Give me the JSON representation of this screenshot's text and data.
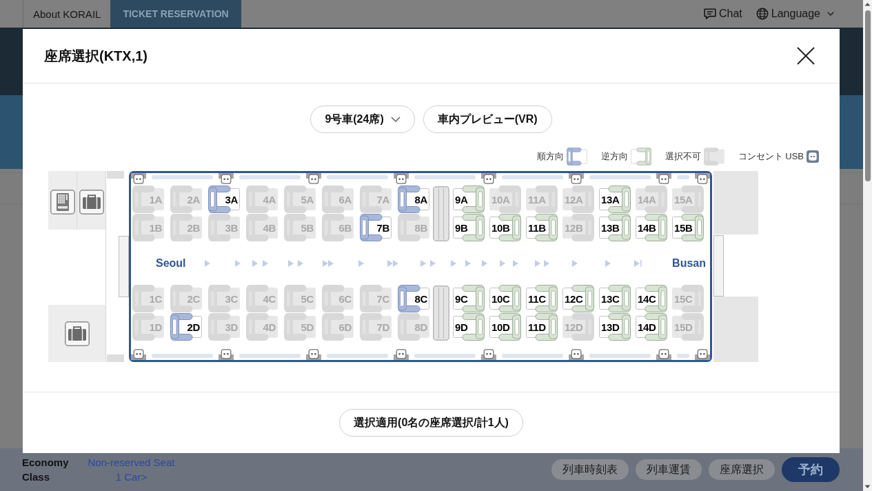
{
  "top_nav": {
    "items": [
      {
        "label": "About KORAIL",
        "selected": false
      },
      {
        "label": "TICKET RESERVATION",
        "selected": true
      }
    ],
    "chat": "Chat",
    "language": "Language"
  },
  "modal": {
    "title": "座席選択(KTX,1)",
    "car_dropdown": "9号車(24席)",
    "vr_button": "車内プレビュー(VR)",
    "legend": [
      {
        "kind": "forward",
        "label": "順方向"
      },
      {
        "kind": "reverse",
        "label": "逆方向"
      },
      {
        "kind": "unavailable",
        "label": "選択不可"
      },
      {
        "kind": "outlet",
        "label": "コンセント USB"
      }
    ],
    "seat_map": {
      "origin": "Seoul",
      "destination": "Busan",
      "rows": [
        {
          "seats": [
            {
              "label": "1A",
              "kind": "forward",
              "available": false
            },
            {
              "label": "2A",
              "kind": "forward",
              "available": false
            },
            {
              "label": "3A",
              "kind": "forward",
              "available": true
            },
            {
              "label": "4A",
              "kind": "forward",
              "available": false
            },
            {
              "label": "5A",
              "kind": "forward",
              "available": false
            },
            {
              "label": "6A",
              "kind": "forward",
              "available": false
            },
            {
              "label": "7A",
              "kind": "forward",
              "available": false
            },
            {
              "label": "8A",
              "kind": "forward",
              "available": true
            },
            {
              "label": "9A",
              "kind": "reverse",
              "available": true
            },
            {
              "label": "10A",
              "kind": "reverse",
              "available": false
            },
            {
              "label": "11A",
              "kind": "reverse",
              "available": false
            },
            {
              "label": "12A",
              "kind": "reverse",
              "available": false
            },
            {
              "label": "13A",
              "kind": "reverse",
              "available": true
            },
            {
              "label": "14A",
              "kind": "reverse",
              "available": false
            },
            {
              "label": "15A",
              "kind": "reverse",
              "available": false
            }
          ]
        },
        {
          "seats": [
            {
              "label": "1B",
              "kind": "forward",
              "available": false
            },
            {
              "label": "2B",
              "kind": "forward",
              "available": false
            },
            {
              "label": "3B",
              "kind": "forward",
              "available": false
            },
            {
              "label": "4B",
              "kind": "forward",
              "available": false
            },
            {
              "label": "5B",
              "kind": "forward",
              "available": false
            },
            {
              "label": "6B",
              "kind": "forward",
              "available": false
            },
            {
              "label": "7B",
              "kind": "forward",
              "available": true
            },
            {
              "label": "8B",
              "kind": "forward",
              "available": false
            },
            {
              "label": "9B",
              "kind": "reverse",
              "available": true
            },
            {
              "label": "10B",
              "kind": "reverse",
              "available": true
            },
            {
              "label": "11B",
              "kind": "reverse",
              "available": true
            },
            {
              "label": "12B",
              "kind": "reverse",
              "available": false
            },
            {
              "label": "13B",
              "kind": "reverse",
              "available": true
            },
            {
              "label": "14B",
              "kind": "reverse",
              "available": true
            },
            {
              "label": "15B",
              "kind": "reverse",
              "available": true
            }
          ]
        },
        {
          "seats": [
            {
              "label": "1C",
              "kind": "forward",
              "available": false
            },
            {
              "label": "2C",
              "kind": "forward",
              "available": false
            },
            {
              "label": "3C",
              "kind": "forward",
              "available": false
            },
            {
              "label": "4C",
              "kind": "forward",
              "available": false
            },
            {
              "label": "5C",
              "kind": "forward",
              "available": false
            },
            {
              "label": "6C",
              "kind": "forward",
              "available": false
            },
            {
              "label": "7C",
              "kind": "forward",
              "available": false
            },
            {
              "label": "8C",
              "kind": "forward",
              "available": true
            },
            {
              "label": "9C",
              "kind": "reverse",
              "available": true
            },
            {
              "label": "10C",
              "kind": "reverse",
              "available": true
            },
            {
              "label": "11C",
              "kind": "reverse",
              "available": true
            },
            {
              "label": "12C",
              "kind": "reverse",
              "available": true
            },
            {
              "label": "13C",
              "kind": "reverse",
              "available": true
            },
            {
              "label": "14C",
              "kind": "reverse",
              "available": true
            },
            {
              "label": "15C",
              "kind": "reverse",
              "available": false
            }
          ]
        },
        {
          "seats": [
            {
              "label": "1D",
              "kind": "forward",
              "available": false
            },
            {
              "label": "2D",
              "kind": "forward",
              "available": true
            },
            {
              "label": "3D",
              "kind": "forward",
              "available": false
            },
            {
              "label": "4D",
              "kind": "forward",
              "available": false
            },
            {
              "label": "5D",
              "kind": "forward",
              "available": false
            },
            {
              "label": "6D",
              "kind": "forward",
              "available": false
            },
            {
              "label": "7D",
              "kind": "forward",
              "available": false
            },
            {
              "label": "8D",
              "kind": "forward",
              "available": false
            },
            {
              "label": "9D",
              "kind": "reverse",
              "available": true
            },
            {
              "label": "10D",
              "kind": "reverse",
              "available": true
            },
            {
              "label": "11D",
              "kind": "reverse",
              "available": true
            },
            {
              "label": "12D",
              "kind": "reverse",
              "available": false
            },
            {
              "label": "13D",
              "kind": "reverse",
              "available": true
            },
            {
              "label": "14D",
              "kind": "reverse",
              "available": true
            },
            {
              "label": "15D",
              "kind": "reverse",
              "available": false
            }
          ]
        }
      ]
    },
    "apply_button": "選択適用(0名の座席選択/計1人)"
  },
  "footer": {
    "seat_class": "Economy Class",
    "seat_type": "Non-reserved Seat",
    "car_link": "1 Car>",
    "buttons": [
      {
        "label": "列車時刻表",
        "kind": "secondary"
      },
      {
        "label": "列車運賃",
        "kind": "secondary"
      },
      {
        "label": "座席選択",
        "kind": "secondary"
      },
      {
        "label": "予約",
        "kind": "primary"
      }
    ]
  }
}
